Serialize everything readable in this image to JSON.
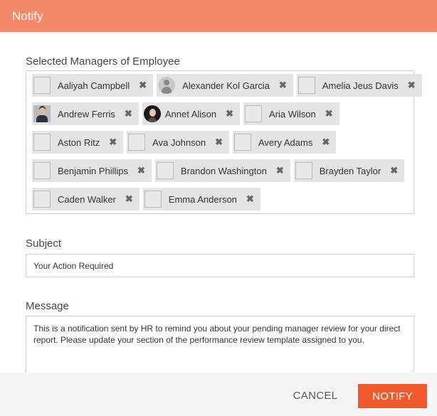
{
  "dialog": {
    "title": "Notify",
    "header_color": "#f4896a",
    "primary_color": "#f05a2e"
  },
  "managers": {
    "label": "Selected Managers of Employee",
    "rows": [
      [
        {
          "name": "Aaliyah Campbell",
          "avatar": "placeholder",
          "remove": "✖"
        },
        {
          "name": "Alexander Kol Garcia",
          "avatar": "generic-person-icon",
          "remove": "✖"
        },
        {
          "name": "Amelia Jeus Davis",
          "avatar": "placeholder",
          "remove": "✖"
        }
      ],
      [
        {
          "name": "Andrew Ferris",
          "avatar": "photo",
          "remove": "✖"
        },
        {
          "name": "Annet Alison",
          "avatar": "photo",
          "remove": "✖"
        },
        {
          "name": "Aria Wilson",
          "avatar": "placeholder",
          "remove": "✖"
        }
      ],
      [
        {
          "name": "Aston Ritz",
          "avatar": "placeholder",
          "remove": "✖"
        },
        {
          "name": "Ava Johnson",
          "avatar": "placeholder",
          "remove": "✖"
        },
        {
          "name": "Avery Adams",
          "avatar": "placeholder",
          "remove": "✖"
        }
      ],
      [
        {
          "name": "Benjamin Phillips",
          "avatar": "placeholder",
          "remove": "✖"
        },
        {
          "name": "Brandon Washington",
          "avatar": "placeholder",
          "remove": "✖"
        },
        {
          "name": "Brayden Taylor",
          "avatar": "placeholder",
          "remove": "✖"
        }
      ],
      [
        {
          "name": "Caden Walker",
          "avatar": "placeholder",
          "remove": "✖"
        },
        {
          "name": "Emma Anderson",
          "avatar": "placeholder",
          "remove": "✖"
        }
      ]
    ]
  },
  "subject": {
    "label": "Subject",
    "value": "Your Action Required"
  },
  "message": {
    "label": "Message",
    "value": "This is a notification sent by HR to remind you about your pending manager review for your direct report. Please update your section of the performance review template assigned to you."
  },
  "footer": {
    "cancel_label": "CANCEL",
    "notify_label": "NOTIFY"
  }
}
